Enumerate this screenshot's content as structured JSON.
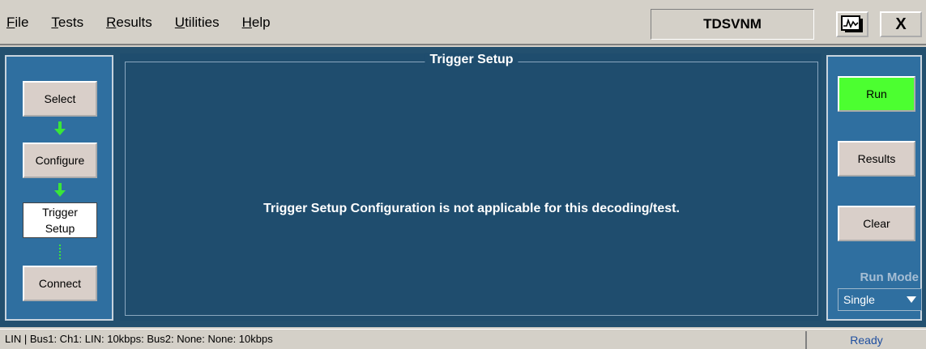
{
  "menu": {
    "items": [
      {
        "key": "F",
        "rest": "ile"
      },
      {
        "key": "T",
        "rest": "ests"
      },
      {
        "key": "R",
        "rest": "esults"
      },
      {
        "key": "U",
        "rest": "tilities"
      },
      {
        "key": "H",
        "rest": "elp"
      }
    ],
    "app_name": "TDSVNM",
    "close_label": "X"
  },
  "steps": {
    "select": "Select",
    "configure": "Configure",
    "trigger_line1": "Trigger",
    "trigger_line2": "Setup",
    "connect": "Connect",
    "active_step": "Trigger Setup"
  },
  "main": {
    "group_title": "Trigger Setup",
    "message": "Trigger Setup Configuration is not applicable for this decoding/test."
  },
  "actions": {
    "run": "Run",
    "results": "Results",
    "clear": "Clear",
    "run_mode_label": "Run Mode",
    "run_mode_value": "Single"
  },
  "status": {
    "info": "LIN  |  Bus1: Ch1: LIN: 10kbps: Bus2: None: None: 10kbps",
    "state": "Ready"
  },
  "colors": {
    "run_button": "#4cff30",
    "panel_bg": "#2f6fa0",
    "main_bg": "#1f4d6e",
    "arrow_green": "#39e639"
  }
}
